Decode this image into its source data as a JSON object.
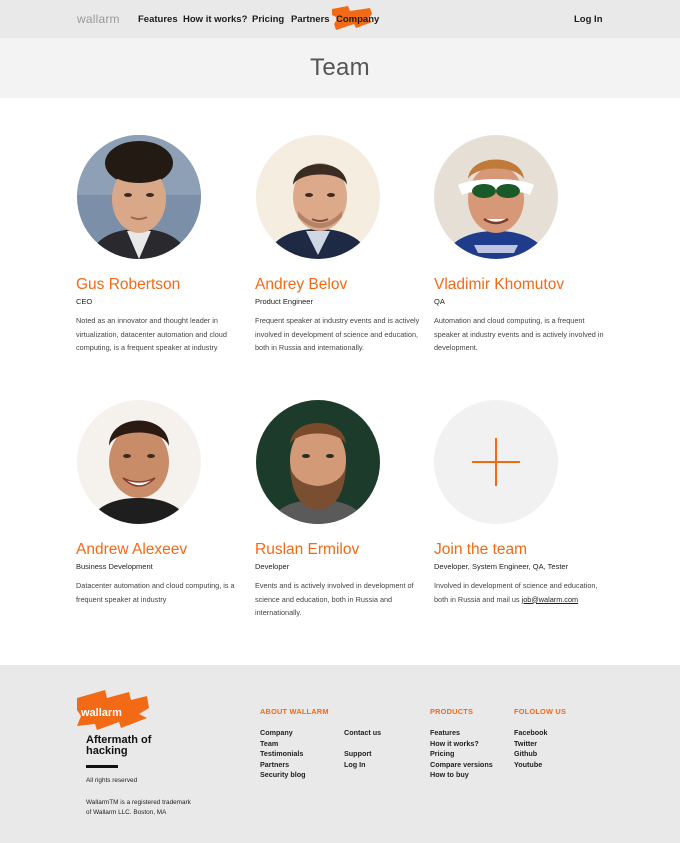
{
  "header": {
    "brand": "wallarm",
    "nav": [
      {
        "label": "Features"
      },
      {
        "label": "How it works?"
      },
      {
        "label": "Pricing"
      },
      {
        "label": "Partners"
      },
      {
        "label": "Company",
        "active": true
      }
    ],
    "login": "Log In"
  },
  "page": {
    "title": "Team"
  },
  "team": [
    {
      "name": "Gus Robertson",
      "role": "CEO",
      "bio": "Noted as an innovator and thought leader in virtualization, datacenter automation and cloud computing, is a frequent speaker at industry",
      "photo": "portrait-photo"
    },
    {
      "name": "Andrey Belov",
      "role": "Product Engineer",
      "bio": "Frequent speaker at industry events and is actively involved in development of science and education, both in Russia and internationally.",
      "photo": "portrait-photo"
    },
    {
      "name": "Vladimir Khomutov",
      "role": "QA",
      "bio": "Automation and cloud computing, is a frequent speaker at industry events and is actively involved in development.",
      "photo": "portrait-photo"
    },
    {
      "name": "Andrew Alexeev",
      "role": "Business Development",
      "bio": "Datacenter automation and cloud computing, is a frequent speaker at industry",
      "photo": "portrait-photo"
    },
    {
      "name": "Ruslan Ermilov",
      "role": "Developer",
      "bio": "Events and is actively involved in development of science and education, both in Russia and internationally.",
      "photo": "portrait-photo"
    }
  ],
  "join": {
    "title": "Join the team",
    "role": "Developer, System Engineer, QA, Tester",
    "bio": "Involved in development of science and education, both in Russia and mail us ",
    "email": "job@walarm.com",
    "icon": "plus-icon"
  },
  "footer": {
    "logo_text": "wallarm",
    "tagline_line1": "Aftermath of",
    "tagline_line2": "hacking",
    "rights": "All rights reserved",
    "trademark_line1": "WallarmTM is a registered trademark",
    "trademark_line2": "of Wallarm LLC. Boston, MA",
    "about": {
      "heading": "ABOUT WALLARM",
      "col1": [
        "Company",
        "Team",
        "Testimonials",
        "Partners",
        "Security blog"
      ],
      "col2": [
        "Contact us",
        "",
        "Support",
        "Log In"
      ]
    },
    "products": {
      "heading": "PRODUCTS",
      "items": [
        "Features",
        "How it works?",
        "Pricing",
        "Compare versions",
        "How to buy"
      ]
    },
    "follow": {
      "heading": "FOLOLOW US",
      "items": [
        "Facebook",
        "Twitter",
        "Github",
        "Youtube"
      ]
    }
  },
  "colors": {
    "accent": "#f26a16",
    "header_bg": "#e9e9e9",
    "title_band_bg": "#f3f3f3",
    "footer_bg": "#e9e9e9"
  }
}
